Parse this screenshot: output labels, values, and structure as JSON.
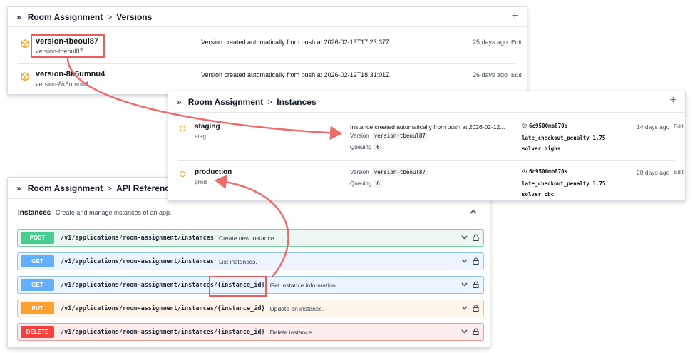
{
  "versions_card": {
    "breadcrumb_app": "Room Assignment",
    "breadcrumb_sep": ">",
    "breadcrumb_page": "Versions",
    "collapse_glyph": "»",
    "add_glyph": "+",
    "rows": [
      {
        "name": "version-tbeoul87",
        "sub": "version-tbeoul87",
        "desc": "Version created automatically from push at 2026-02-13T17:23:37Z",
        "ago": "25 days ago",
        "edit": "Edit"
      },
      {
        "name": "version-8k6umnu4",
        "sub": "version-8k6umnu4",
        "desc": "Version created automatically from push at 2026-02-12T18:31:01Z",
        "ago": "26 days ago",
        "edit": "Edit"
      }
    ]
  },
  "instances_card": {
    "breadcrumb_app": "Room Assignment",
    "breadcrumb_sep": ">",
    "breadcrumb_page": "Instances",
    "collapse_glyph": "»",
    "add_glyph": "+",
    "version_label": "Version",
    "queuing_label": "Queuing",
    "rows": [
      {
        "name": "staging",
        "sub": "stag",
        "desc": "Instance created automatically from push at 2026-02-12...",
        "version": "version-tbeoul87",
        "queuing": "6",
        "hash": "6c9500mb870s",
        "cfg1": "late_checkout_penalty 1.75",
        "cfg2": "solver highs",
        "ago": "14 days ago",
        "edit": "Edit"
      },
      {
        "name": "production",
        "sub": "prod",
        "desc": "",
        "version": "version-tbeoul87",
        "queuing": "6",
        "hash": "6c9500mb870s",
        "cfg1": "late_checkout_penalty 1.75",
        "cfg2": "solver cbc",
        "ago": "20 days ago",
        "edit": "Edit"
      }
    ]
  },
  "api_card": {
    "breadcrumb_app": "Room Assignment",
    "breadcrumb_sep": ">",
    "breadcrumb_page": "API Reference",
    "collapse_glyph": "»",
    "section_title": "Instances",
    "section_desc": "Create and manage instances of an app.",
    "chevron_up": "^",
    "endpoints": [
      {
        "method": "POST",
        "path": "/v1/applications/room-assignment/instances",
        "desc": "Create new instance."
      },
      {
        "method": "GET",
        "path": "/v1/applications/room-assignment/instances",
        "desc": "List instances."
      },
      {
        "method": "GET",
        "path": "/v1/applications/room-assignment/instances/{instance_id}",
        "desc": "Get instance information."
      },
      {
        "method": "PUT",
        "path": "/v1/applications/room-assignment/instances/{instance_id}",
        "desc": "Update an instance."
      },
      {
        "method": "DELETE",
        "path": "/v1/applications/room-assignment/instances/{instance_id}",
        "desc": "Delete instance."
      }
    ],
    "chevron_down": "v"
  },
  "colors": {
    "highlight": "#e95d5d",
    "post": "#49cc90",
    "get": "#61affe",
    "put": "#fca130",
    "delete": "#f93e3e",
    "status_dot": "#f59e0b",
    "cube": "#f5a524"
  }
}
